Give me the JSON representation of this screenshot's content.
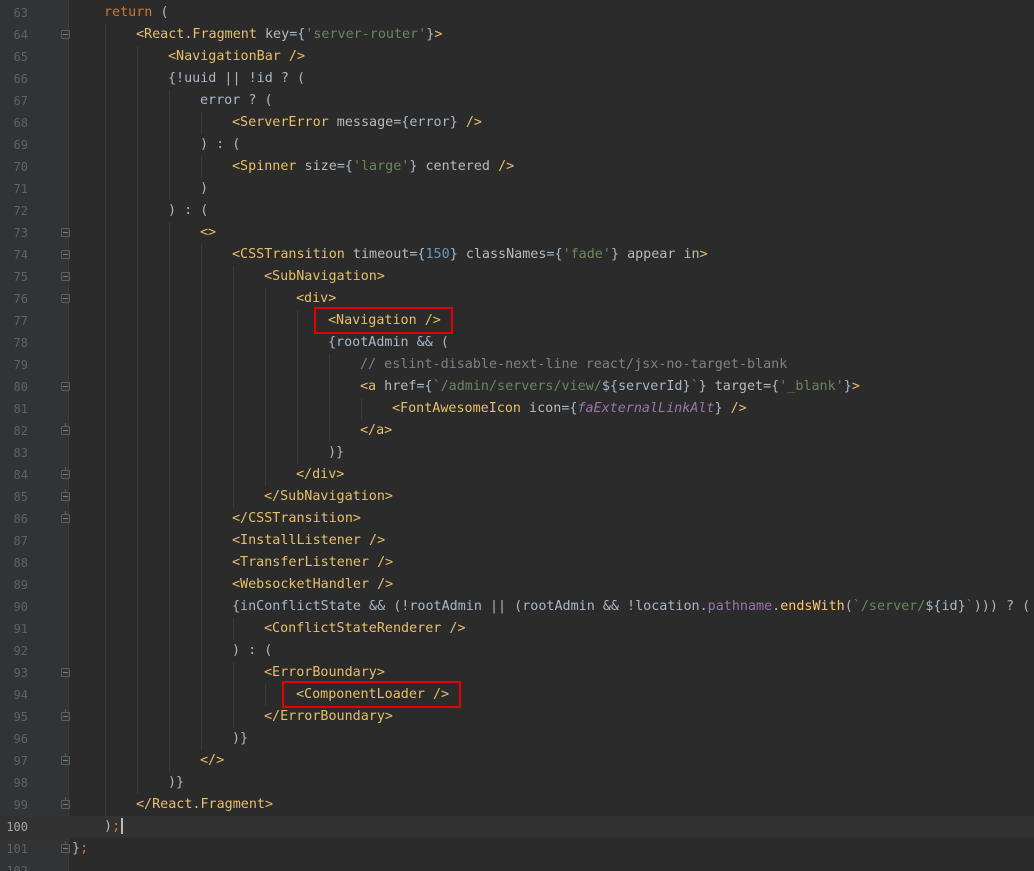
{
  "editor": {
    "current_line": "100",
    "highlight_color": "#e60000",
    "highlights": [
      {
        "name": "highlight-navigation",
        "text": "<Navigation />"
      },
      {
        "name": "highlight-component-loader",
        "text": "<ComponentLoader />"
      }
    ]
  },
  "lines": [
    {
      "n": "63",
      "indent": 1,
      "fold": "",
      "tokens": [
        [
          "kw",
          "return"
        ],
        [
          "plain",
          " ("
        ]
      ]
    },
    {
      "n": "64",
      "indent": 2,
      "fold": "start",
      "tokens": [
        [
          "tag",
          "<React.Fragment"
        ],
        [
          "attr",
          " key"
        ],
        [
          "plain",
          "={"
        ],
        [
          "str",
          "'server-router'"
        ],
        [
          "plain",
          "}"
        ],
        [
          "tag",
          ">"
        ]
      ]
    },
    {
      "n": "65",
      "indent": 3,
      "fold": "",
      "tokens": [
        [
          "tag",
          "<NavigationBar />"
        ]
      ]
    },
    {
      "n": "66",
      "indent": 3,
      "fold": "",
      "tokens": [
        [
          "plain",
          "{!uuid || !id ? ("
        ]
      ]
    },
    {
      "n": "67",
      "indent": 4,
      "fold": "",
      "tokens": [
        [
          "plain",
          "error ? ("
        ]
      ]
    },
    {
      "n": "68",
      "indent": 5,
      "fold": "",
      "tokens": [
        [
          "tag",
          "<ServerError"
        ],
        [
          "attr",
          " message"
        ],
        [
          "plain",
          "={error} "
        ],
        [
          "tag",
          "/>"
        ]
      ]
    },
    {
      "n": "69",
      "indent": 4,
      "fold": "",
      "tokens": [
        [
          "plain",
          ") : ("
        ]
      ]
    },
    {
      "n": "70",
      "indent": 5,
      "fold": "",
      "tokens": [
        [
          "tag",
          "<Spinner"
        ],
        [
          "attr",
          " size"
        ],
        [
          "plain",
          "={"
        ],
        [
          "str",
          "'large'"
        ],
        [
          "plain",
          "} "
        ],
        [
          "attr",
          "centered"
        ],
        [
          "plain",
          " "
        ],
        [
          "tag",
          "/>"
        ]
      ]
    },
    {
      "n": "71",
      "indent": 4,
      "fold": "",
      "tokens": [
        [
          "plain",
          ")"
        ]
      ]
    },
    {
      "n": "72",
      "indent": 3,
      "fold": "",
      "tokens": [
        [
          "plain",
          ") : ("
        ]
      ]
    },
    {
      "n": "73",
      "indent": 4,
      "fold": "start",
      "tokens": [
        [
          "tag",
          "<>"
        ]
      ]
    },
    {
      "n": "74",
      "indent": 5,
      "fold": "start",
      "tokens": [
        [
          "tag",
          "<CSSTransition"
        ],
        [
          "attr",
          " timeout"
        ],
        [
          "plain",
          "={"
        ],
        [
          "num",
          "150"
        ],
        [
          "plain",
          "} "
        ],
        [
          "attr",
          "classNames"
        ],
        [
          "plain",
          "={"
        ],
        [
          "str",
          "'fade'"
        ],
        [
          "plain",
          "} "
        ],
        [
          "attr",
          "appear in"
        ],
        [
          "tag",
          ">"
        ]
      ]
    },
    {
      "n": "75",
      "indent": 6,
      "fold": "start",
      "tokens": [
        [
          "tag",
          "<SubNavigation>"
        ]
      ]
    },
    {
      "n": "76",
      "indent": 7,
      "fold": "start",
      "tokens": [
        [
          "tag",
          "<div>"
        ]
      ]
    },
    {
      "n": "77",
      "indent": 8,
      "fold": "",
      "tokens": [
        [
          "tag",
          "<Navigation />"
        ]
      ]
    },
    {
      "n": "78",
      "indent": 8,
      "fold": "",
      "tokens": [
        [
          "plain",
          "{rootAdmin && ("
        ]
      ]
    },
    {
      "n": "79",
      "indent": 9,
      "fold": "",
      "tokens": [
        [
          "com",
          "// eslint-disable-next-line react/jsx-no-target-blank"
        ]
      ]
    },
    {
      "n": "80",
      "indent": 9,
      "fold": "start",
      "tokens": [
        [
          "tag",
          "<a"
        ],
        [
          "attr",
          " href"
        ],
        [
          "plain",
          "={"
        ],
        [
          "str",
          "`/admin/servers/view/"
        ],
        [
          "plain",
          "${serverId}"
        ],
        [
          "str",
          "`"
        ],
        [
          "plain",
          "} "
        ],
        [
          "attr",
          "target"
        ],
        [
          "plain",
          "={"
        ],
        [
          "str",
          "'_blank'"
        ],
        [
          "plain",
          "}"
        ],
        [
          "tag",
          ">"
        ]
      ]
    },
    {
      "n": "81",
      "indent": 10,
      "fold": "",
      "tokens": [
        [
          "tag",
          "<FontAwesomeIcon"
        ],
        [
          "attr",
          " icon"
        ],
        [
          "plain",
          "={"
        ],
        [
          "italic",
          "faExternalLinkAlt"
        ],
        [
          "plain",
          "} "
        ],
        [
          "tag",
          "/>"
        ]
      ]
    },
    {
      "n": "82",
      "indent": 9,
      "fold": "end",
      "tokens": [
        [
          "tag",
          "</a>"
        ]
      ]
    },
    {
      "n": "83",
      "indent": 8,
      "fold": "",
      "tokens": [
        [
          "plain",
          ")}"
        ]
      ]
    },
    {
      "n": "84",
      "indent": 7,
      "fold": "end",
      "tokens": [
        [
          "tag",
          "</div>"
        ]
      ]
    },
    {
      "n": "85",
      "indent": 6,
      "fold": "end",
      "tokens": [
        [
          "tag",
          "</SubNavigation>"
        ]
      ]
    },
    {
      "n": "86",
      "indent": 5,
      "fold": "end",
      "tokens": [
        [
          "tag",
          "</CSSTransition>"
        ]
      ]
    },
    {
      "n": "87",
      "indent": 5,
      "fold": "",
      "tokens": [
        [
          "tag",
          "<InstallListener />"
        ]
      ]
    },
    {
      "n": "88",
      "indent": 5,
      "fold": "",
      "tokens": [
        [
          "tag",
          "<TransferListener />"
        ]
      ]
    },
    {
      "n": "89",
      "indent": 5,
      "fold": "",
      "tokens": [
        [
          "tag",
          "<WebsocketHandler />"
        ]
      ]
    },
    {
      "n": "90",
      "indent": 5,
      "fold": "",
      "tokens": [
        [
          "plain",
          "{inConflictState && (!rootAdmin || (rootAdmin && !location."
        ],
        [
          "prop",
          "pathname"
        ],
        [
          "plain",
          "."
        ],
        [
          "fn",
          "endsWith"
        ],
        [
          "plain",
          "("
        ],
        [
          "str",
          "`/server/"
        ],
        [
          "plain",
          "${id}"
        ],
        [
          "str",
          "`"
        ],
        [
          "plain",
          "))) ? ("
        ]
      ]
    },
    {
      "n": "91",
      "indent": 6,
      "fold": "",
      "tokens": [
        [
          "tag",
          "<ConflictStateRenderer />"
        ]
      ]
    },
    {
      "n": "92",
      "indent": 5,
      "fold": "",
      "tokens": [
        [
          "plain",
          ") : ("
        ]
      ]
    },
    {
      "n": "93",
      "indent": 6,
      "fold": "start",
      "tokens": [
        [
          "tag",
          "<ErrorBoundary>"
        ]
      ]
    },
    {
      "n": "94",
      "indent": 7,
      "fold": "",
      "tokens": [
        [
          "tag",
          "<ComponentLoader />"
        ]
      ]
    },
    {
      "n": "95",
      "indent": 6,
      "fold": "end",
      "tokens": [
        [
          "tag",
          "</ErrorBoundary>"
        ]
      ]
    },
    {
      "n": "96",
      "indent": 5,
      "fold": "",
      "tokens": [
        [
          "plain",
          ")}"
        ]
      ]
    },
    {
      "n": "97",
      "indent": 4,
      "fold": "end",
      "tokens": [
        [
          "tag",
          "</>"
        ]
      ]
    },
    {
      "n": "98",
      "indent": 3,
      "fold": "",
      "tokens": [
        [
          "plain",
          ")}"
        ]
      ]
    },
    {
      "n": "99",
      "indent": 2,
      "fold": "end",
      "tokens": [
        [
          "tag",
          "</React.Fragment>"
        ]
      ]
    },
    {
      "n": "100",
      "indent": 1,
      "fold": "",
      "tokens": [
        [
          "plain",
          ")"
        ],
        [
          "kw",
          ";"
        ]
      ]
    },
    {
      "n": "101",
      "indent": 0,
      "fold": "end",
      "tokens": [
        [
          "plain",
          "}"
        ],
        [
          "kw",
          ";"
        ]
      ]
    },
    {
      "n": "102",
      "indent": 0,
      "fold": "",
      "tokens": []
    }
  ]
}
